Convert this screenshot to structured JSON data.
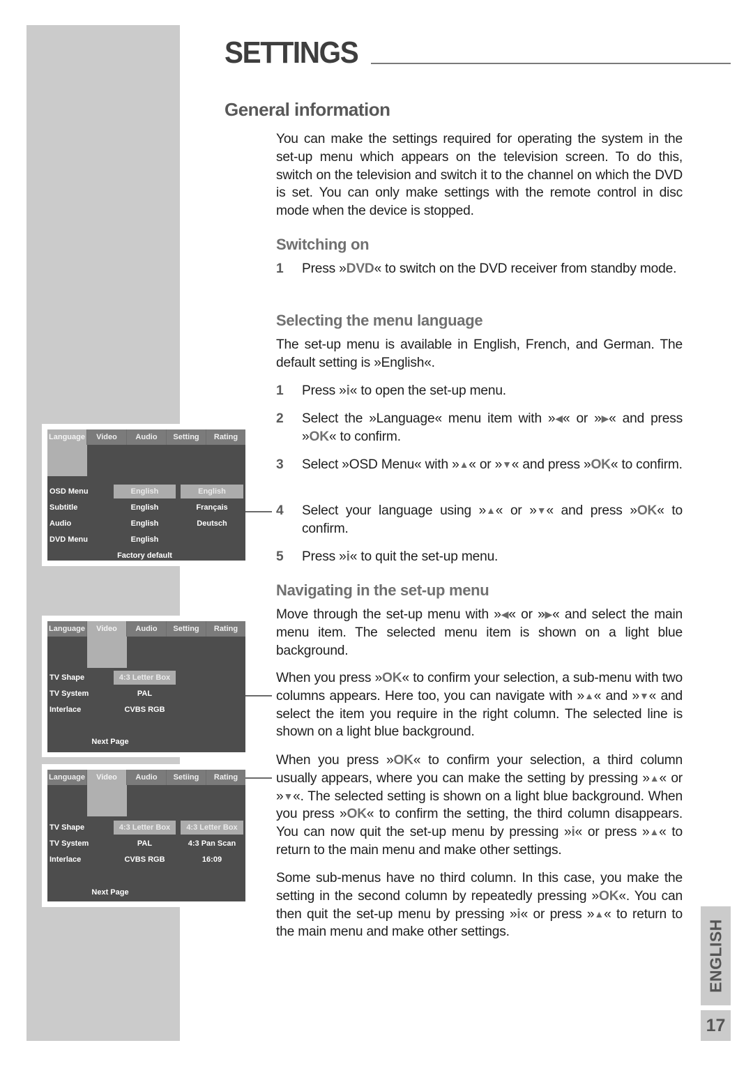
{
  "header": {
    "title": "SETTINGS"
  },
  "section": {
    "title": "General information",
    "intro": "You can make the settings required for operating the system in the set-up menu which appears on the television screen. To do this, switch on the television and switch it to the channel on which the DVD is set. You can only make settings with the remote control in disc mode when the device is stopped."
  },
  "switching_on": {
    "title": "Switching on",
    "steps": [
      {
        "num": "1",
        "pre": "Press »",
        "key": "DVD",
        "post": "« to switch on the DVD receiver from standby mode."
      }
    ]
  },
  "menu_language": {
    "title": "Selecting the menu language",
    "intro": "The set-up menu is available in English, French, and German. The default setting is »English«.",
    "steps": [
      {
        "num": "1",
        "a": "Press »",
        "key1": "i",
        "b": "« to open the set-up menu."
      },
      {
        "num": "2",
        "a": "Select the »Language« menu item with »",
        "b": "« or »",
        "c": "« and press »",
        "key1": "OK",
        "d": "« to confirm."
      },
      {
        "num": "3",
        "a": "Select »OSD Menu« with »",
        "b": "« or »",
        "c": "« and press »",
        "key1": "OK",
        "d": "« to confirm."
      },
      {
        "num": "4",
        "a": "Select your language using »",
        "b": "« or »",
        "c": "« and press »",
        "key1": "OK",
        "d": "« to confirm."
      },
      {
        "num": "5",
        "a": "Press »",
        "key1": "i",
        "b": "« to quit the set-up menu."
      }
    ]
  },
  "navigating": {
    "title": "Navigating in the set-up menu",
    "p1": {
      "a": "Move through the set-up menu with »",
      "b": "« or »",
      "c": "« and select the main menu item. The selected menu item is shown on a light blue background."
    },
    "p2": {
      "a": "When you press »",
      "key": "OK",
      "b": "« to confirm your selection, a sub-menu with two columns appears. Here too, you can navigate with »",
      "c": "« and »",
      "d": "« and select the item you require in the right column. The selected line is shown on a light blue background."
    },
    "p3": {
      "a": "When you press »",
      "key": "OK",
      "b": "« to confirm your selection, a third column usually appears, where you can make the setting by pressing »",
      "c": "« or »",
      "d": "«. The selected setting is shown on a light blue background. When you press »",
      "key2": "OK",
      "e": "« to confirm the setting, the third column disappears. You can now quit the set-up menu by pressing »",
      "key3": "i",
      "f": "« or press »",
      "g": "« to return to the main menu and make other settings."
    },
    "p4": {
      "a": "Some sub-menus have no third column. In this case, you make the setting in the second column by repeatedly pressing »",
      "key": "OK",
      "b": "«. You can then quit the set-up menu by pressing »",
      "key2": "i",
      "c": "« or press »",
      "d": "« to return to the main menu and make other settings."
    }
  },
  "icons": {
    "left": "◀",
    "right": "▶",
    "up": "▲",
    "down": "▼"
  },
  "screens": [
    {
      "tabs": [
        "Language",
        "Video",
        "Audio",
        "Setting",
        "Rating"
      ],
      "selected_tab": "Language",
      "rows": [
        {
          "label": "OSD Menu",
          "c2": "English",
          "c3": "English"
        },
        {
          "label": "Subtitle",
          "c2": "English",
          "c3": "Français"
        },
        {
          "label": "Audio",
          "c2": "English",
          "c3": "Deutsch"
        },
        {
          "label": "DVD Menu",
          "c2": "English",
          "c3": ""
        }
      ],
      "footer": "Factory default"
    },
    {
      "tabs": [
        "Language",
        "Video",
        "Audio",
        "Setting",
        "Rating"
      ],
      "selected_tab": "Video",
      "rows": [
        {
          "label": "TV Shape",
          "c2": "4:3 Letter Box",
          "c3": ""
        },
        {
          "label": "TV System",
          "c2": "PAL",
          "c3": ""
        },
        {
          "label": "Interlace",
          "c2": "CVBS RGB",
          "c3": ""
        }
      ],
      "footer": "Next Page"
    },
    {
      "tabs": [
        "Language",
        "Video",
        "Audio",
        "Setiing",
        "Rating"
      ],
      "selected_tab": "Video",
      "rows": [
        {
          "label": "TV Shape",
          "c2": "4:3 Letter Box",
          "c3": "4:3 Letter Box"
        },
        {
          "label": "TV System",
          "c2": "PAL",
          "c3": "4:3 Pan Scan"
        },
        {
          "label": "Interlace",
          "c2": "CVBS RGB",
          "c3": "16:09"
        }
      ],
      "footer": "Next Page"
    }
  ],
  "side_tab": {
    "language": "ENGLISH",
    "page_number": "17"
  }
}
